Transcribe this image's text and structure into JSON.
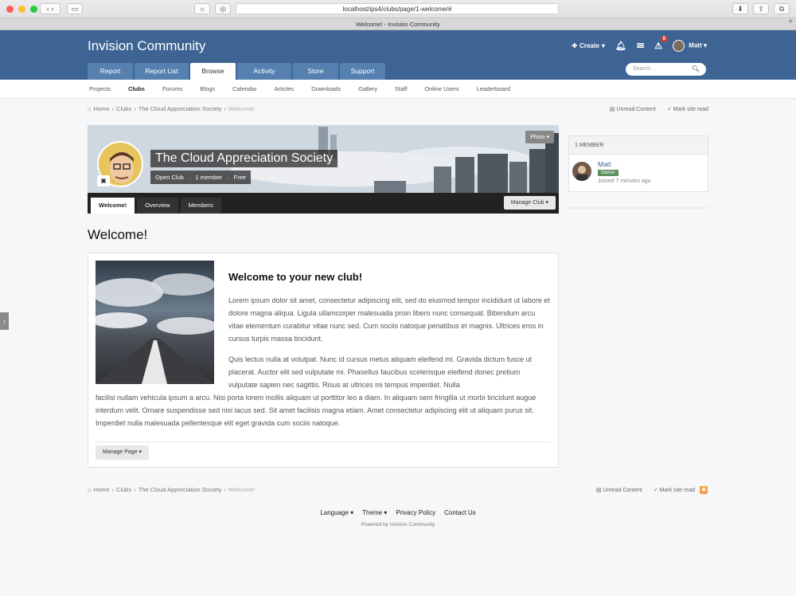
{
  "browser": {
    "url": "localhost/ips4/clubs/page/1-welcome/#",
    "tab_title": "Welcome! - Invision Community"
  },
  "header": {
    "site_title": "Invision Community",
    "create_label": "Create",
    "notification_count": "8",
    "user_name": "Matt",
    "search_placeholder": "Search...",
    "nav_tabs": [
      {
        "label": "Report"
      },
      {
        "label": "Report List"
      },
      {
        "label": "Browse"
      },
      {
        "label": "Activity"
      },
      {
        "label": "Store"
      },
      {
        "label": "Support"
      }
    ],
    "active_tab": "Browse"
  },
  "subnav": {
    "items": [
      {
        "label": "Projects"
      },
      {
        "label": "Clubs"
      },
      {
        "label": "Forums"
      },
      {
        "label": "Blogs"
      },
      {
        "label": "Calendar"
      },
      {
        "label": "Articles"
      },
      {
        "label": "Downloads"
      },
      {
        "label": "Gallery"
      },
      {
        "label": "Staff"
      },
      {
        "label": "Online Users"
      },
      {
        "label": "Leaderboard"
      }
    ],
    "active": "Clubs"
  },
  "breadcrumb": {
    "home": "Home",
    "clubs": "Clubs",
    "club": "The Cloud Appreciation Society",
    "current": "Welcome!",
    "unread": "Unread Content",
    "mark_read": "Mark site read"
  },
  "club": {
    "photo_button": "Photo",
    "name": "The Cloud Appreciation Society",
    "type": "Open Club",
    "members": "1 member",
    "price": "Free",
    "tabs": [
      {
        "label": "Welcome!"
      },
      {
        "label": "Overview"
      },
      {
        "label": "Members"
      }
    ],
    "manage_button": "Manage Club"
  },
  "sidebar": {
    "header": "1 MEMBER",
    "member_name": "Matt",
    "member_role": "Owner",
    "member_joined": "Joined 7 minutes ago"
  },
  "page": {
    "heading": "Welcome!",
    "content_title": "Welcome to your new club!",
    "paragraph1": "Lorem ipsum dolor sit amet, consectetur adipiscing elit, sed do eiusmod tempor incididunt ut labore et dolore magna aliqua. Ligula ullamcorper malesuada proin libero nunc consequat. Bibendum arcu vitae elementum curabitur vitae nunc sed. Cum sociis natoque penatibus et magnis. Ultrices eros in cursus turpis massa tincidunt.",
    "paragraph2a": "Quis lectus nulla at volutpat. Nunc id cursus metus aliquam eleifend mi. Gravida dictum fusce ut placerat. Auctor elit sed vulputate mi. Phasellus faucibus scelerisque eleifend donec pretium vulputate sapien nec sagittis. Risus at ultrices mi tempus imperdiet. Nulla",
    "paragraph2b": "facilisi nullam vehicula ipsum a arcu. Nisi porta lorem mollis aliquam ut porttitor leo a diam. In aliquam sem fringilla ut morbi tincidunt augue interdum velit. Ornare suspendisse sed nisi lacus sed. Sit amet facilisis magna etiam. Amet consectetur adipiscing elit ut aliquam purus sit. Imperdiet nulla malesuada pellentesque elit eget gravida cum sociis natoque.",
    "manage_button": "Manage Page"
  },
  "footer": {
    "language": "Language",
    "theme": "Theme",
    "privacy": "Privacy Policy",
    "contact": "Contact Us",
    "powered": "Powered by Invision Community"
  }
}
